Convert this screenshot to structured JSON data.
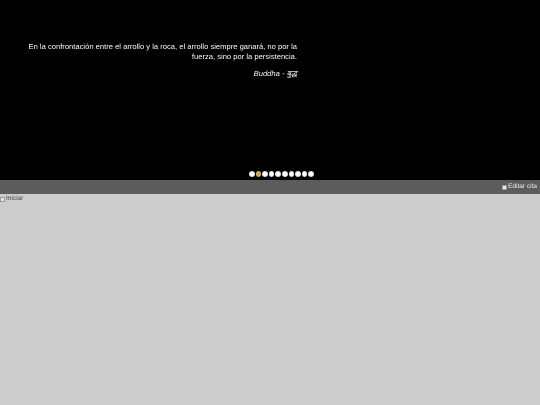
{
  "quote": {
    "text": "En la confrontación entre el arrollo y la roca, el arrollo siempre ganará, no por la fuerza, sino por la persistencia.",
    "author": "Buddha - बुद्ध"
  },
  "carousel": {
    "slide_count": 10,
    "active_index": 1,
    "active_color": "#d8a93a",
    "inactive_color": "#ffffff"
  },
  "toolbar": {
    "edit_label": "Editar cita",
    "edit_icon": "broken-image-icon"
  },
  "nav": {
    "home_label": "Iniciar",
    "home_icon": "broken-image-icon"
  },
  "colors": {
    "quote_background": "#000000",
    "toolbar_background": "#5c5c5c",
    "page_background": "#cccccc"
  }
}
